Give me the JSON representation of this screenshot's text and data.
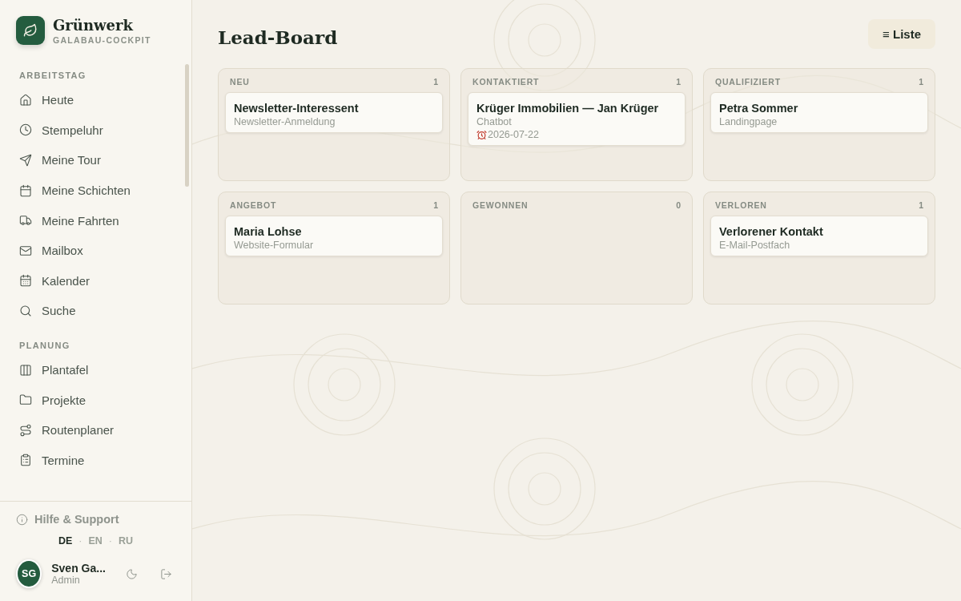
{
  "brand": {
    "name": "Grünwerk",
    "subtitle": "GALABAU-COCKPIT"
  },
  "sidebar": {
    "sections": [
      {
        "title": "ARBEITSTAG",
        "items": [
          {
            "label": "Heute",
            "selected": false
          },
          {
            "label": "Stempeluhr",
            "selected": false
          },
          {
            "label": "Meine Tour",
            "selected": false
          },
          {
            "label": "Meine Schichten",
            "selected": false
          },
          {
            "label": "Meine Fahrten",
            "selected": false
          },
          {
            "label": "Mailbox",
            "selected": false
          },
          {
            "label": "Kalender",
            "selected": false
          },
          {
            "label": "Suche",
            "selected": false
          }
        ]
      },
      {
        "title": "PLANUNG",
        "items": [
          {
            "label": "Plantafel",
            "selected": false
          },
          {
            "label": "Projekte",
            "selected": false
          },
          {
            "label": "Routenplaner",
            "selected": false
          },
          {
            "label": "Termine",
            "selected": false
          }
        ]
      }
    ],
    "help": "Hilfe & Support",
    "languages": [
      {
        "label": "DE",
        "selected": true
      },
      {
        "label": "EN",
        "selected": false
      },
      {
        "label": "RU",
        "selected": false
      }
    ],
    "language_separator": "·",
    "user": {
      "initials": "SG",
      "name": "Sven Ga...",
      "role": "Admin"
    }
  },
  "page": {
    "title": "Lead-Board",
    "view_button": {
      "icon_char": "≡",
      "label": "Liste"
    }
  },
  "columns": [
    {
      "title": "NEU",
      "count": "1",
      "cards": [
        {
          "title": "Newsletter-Interessent",
          "source": "Newsletter-Anmeldung"
        }
      ]
    },
    {
      "title": "KONTAKTIERT",
      "count": "1",
      "cards": [
        {
          "title": "Krüger Immobilien — Jan Krüger",
          "source": "Chatbot",
          "reminder": "2026-07-22"
        }
      ]
    },
    {
      "title": "QUALIFIZIERT",
      "count": "1",
      "cards": [
        {
          "title": "Petra Sommer",
          "source": "Landingpage"
        }
      ]
    },
    {
      "title": "ANGEBOT",
      "count": "1",
      "cards": [
        {
          "title": "Maria Lohse",
          "source": "Website-Formular"
        }
      ]
    },
    {
      "title": "GEWONNEN",
      "count": "0"
    },
    {
      "title": "VERLOREN",
      "count": "1",
      "cards": [
        {
          "title": "Verlorener Kontakt",
          "source": "E-Mail-Postfach"
        }
      ]
    }
  ]
}
